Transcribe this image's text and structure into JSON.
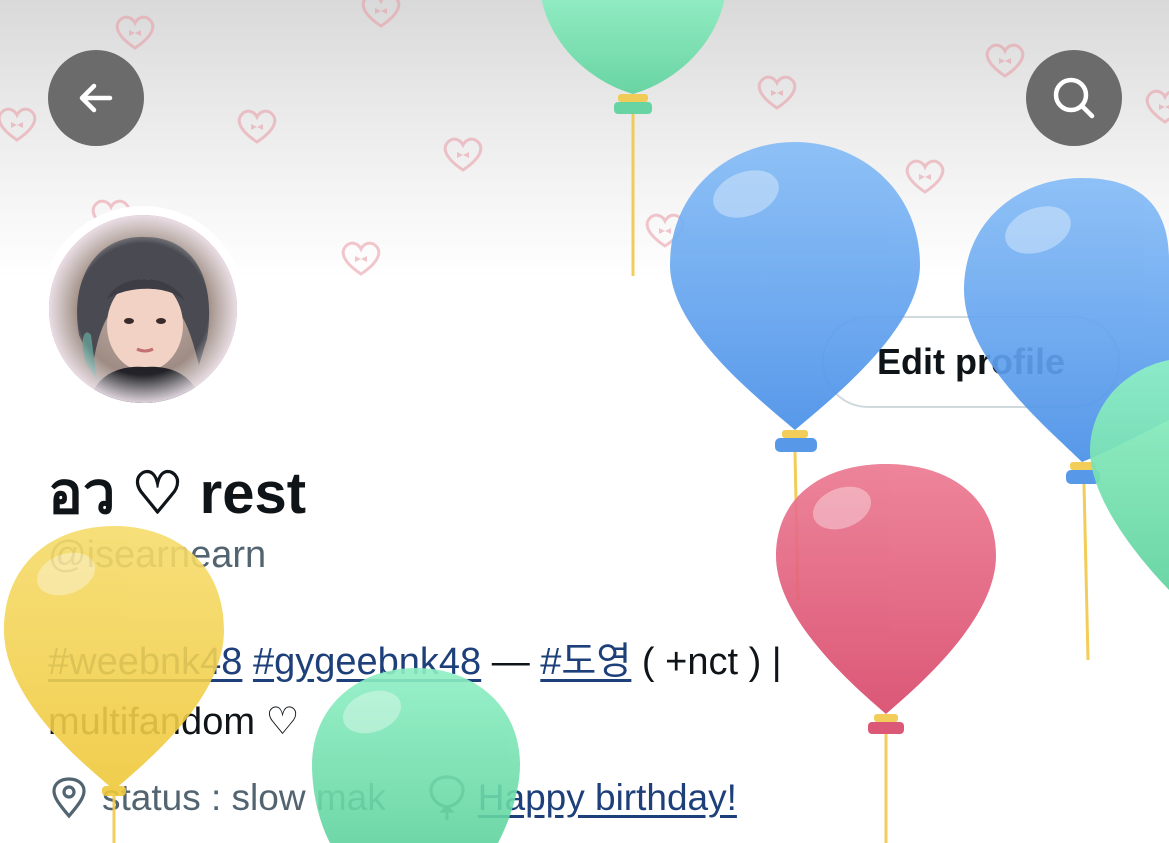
{
  "header": {
    "back_icon": "arrow-left-icon",
    "search_icon": "search-icon",
    "banner_pattern": "pink-heart-bow-pattern"
  },
  "profile": {
    "display_name": "อว ♡ rest",
    "handle": "@isearnearn",
    "edit_button_label": "Edit profile",
    "bio": {
      "tag1": "#weebnk48",
      "tag2": "#gygeebnk48",
      "dash": "—",
      "tag3": "#도영",
      "text1": "( +nct ) |",
      "text2": "multifandom ♡"
    },
    "location": "status : slow mak",
    "location_icon": "map-pin-icon",
    "birthday_icon": "balloon-icon",
    "birthday_link": "Happy birthday!"
  },
  "colors": {
    "link": "#1d3f7a",
    "secondary_text": "#536471",
    "balloon_blue": "#5aa0f0",
    "balloon_green": "#6fdba8",
    "balloon_red": "#e05a78",
    "balloon_yellow": "#f3d04f"
  }
}
